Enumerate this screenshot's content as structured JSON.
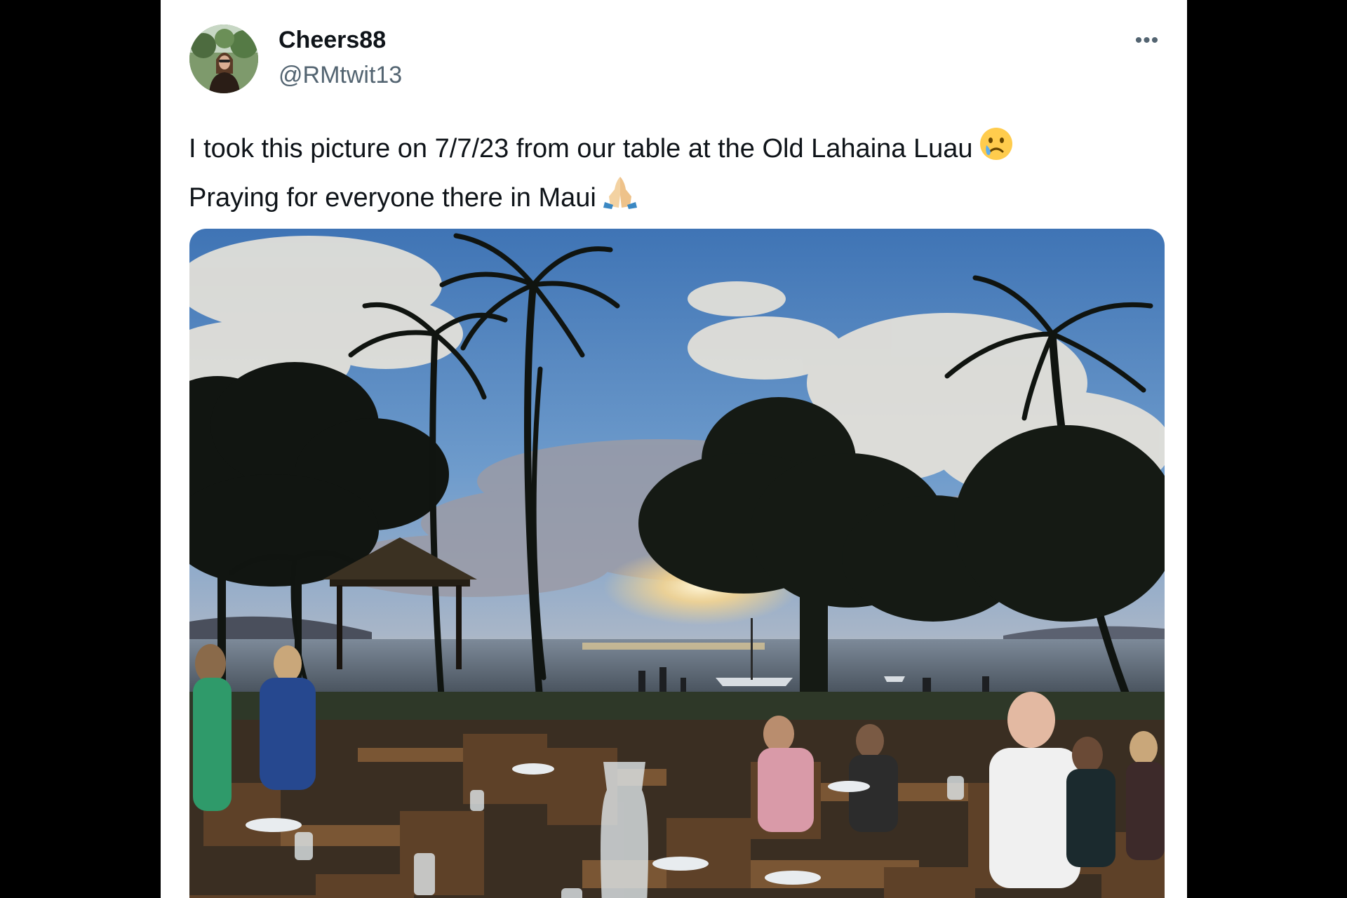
{
  "tweet": {
    "display_name": "Cheers88",
    "handle": "@RMtwit13",
    "more_icon": "more-horizontal-icon",
    "text_line1": "I took this picture on 7/7/23 from our table at the Old Lahaina Luau",
    "text_line2": "Praying for everyone there in Maui",
    "emoji1": "crying-face-icon",
    "emoji2": "praying-hands-icon"
  },
  "media": {
    "description": "sunset-luau-photo"
  },
  "colors": {
    "text_primary": "#0f1419",
    "text_secondary": "#536471",
    "background": "#ffffff",
    "frame": "#000000"
  }
}
